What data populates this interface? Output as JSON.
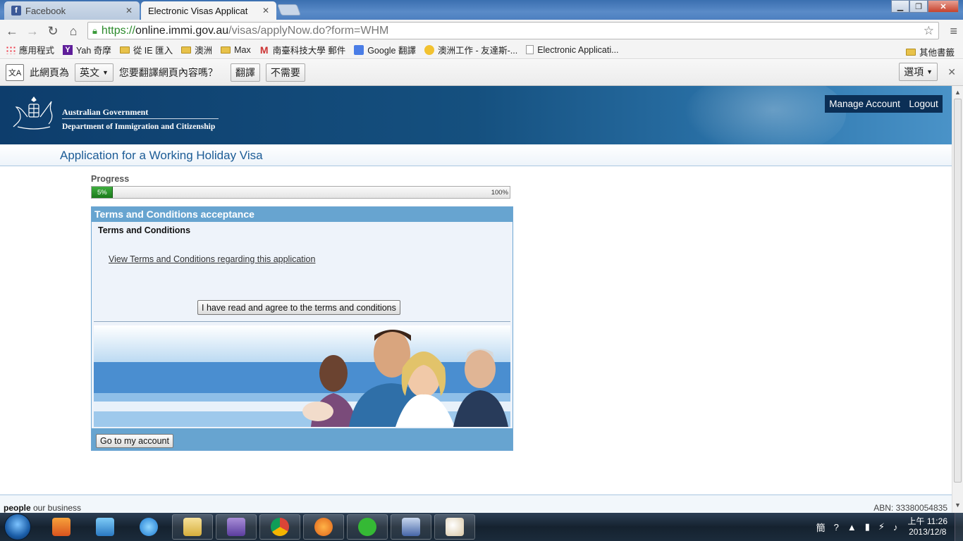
{
  "browser": {
    "tabs": [
      {
        "label": "Facebook",
        "active": false
      },
      {
        "label": "Electronic Visas Applicat",
        "active": true
      }
    ],
    "url": {
      "scheme": "https://",
      "host": "online.immi.gov.au",
      "path": "/visas/applyNow.do?form=WHM"
    },
    "bookmarks": [
      {
        "label": "應用程式",
        "icon": "apps-icon"
      },
      {
        "label": "Yah 奇摩",
        "icon": "yahoo-icon"
      },
      {
        "label": "從 IE 匯入",
        "icon": "folder-icon"
      },
      {
        "label": "澳洲",
        "icon": "folder-icon"
      },
      {
        "label": "Max",
        "icon": "folder-icon"
      },
      {
        "label": "南臺科技大學 郵件",
        "icon": "gmail-icon"
      },
      {
        "label": "Google 翻譯",
        "icon": "google-translate-icon"
      },
      {
        "label": "澳洲工作 - 友達斯-...",
        "icon": "sun-icon"
      },
      {
        "label": "Electronic Applicati...",
        "icon": "page-icon"
      }
    ],
    "bookmarks_other": "其他書籤",
    "translate_bar": {
      "prefix": "此網頁為",
      "language": "英文",
      "question": "您要翻譯網頁內容嗎？",
      "translate_label": "翻譯",
      "nope_label": "不需要",
      "options_label": "選項"
    }
  },
  "site": {
    "gov_name": "Australian Government",
    "dept_name": "Department of Immigration and Citizenship",
    "manage_account": "Manage Account",
    "logout": "Logout",
    "page_title": "Application for a Working Holiday Visa"
  },
  "progress": {
    "label": "Progress",
    "fraction": 0.05,
    "start_text": "5%",
    "end_text": "100%"
  },
  "terms": {
    "heading": "Terms and Conditions acceptance",
    "subheading": "Terms and Conditions",
    "link": "View Terms and Conditions regarding this application",
    "agree_button": "I have read and agree to the terms and conditions",
    "account_button": "Go to my account"
  },
  "footer": {
    "tagline_bold": "people",
    "tagline_rest": " our business",
    "abn": "ABN: 33380054835"
  },
  "taskbar": {
    "time": "上午 11:26",
    "date": "2013/12/8",
    "ime": "簡"
  },
  "colors": {
    "header_blue": "#0d3d6c",
    "panel_blue": "#67a4d0",
    "progress_green": "#1b7a1b",
    "title_blue": "#1c5c96"
  }
}
